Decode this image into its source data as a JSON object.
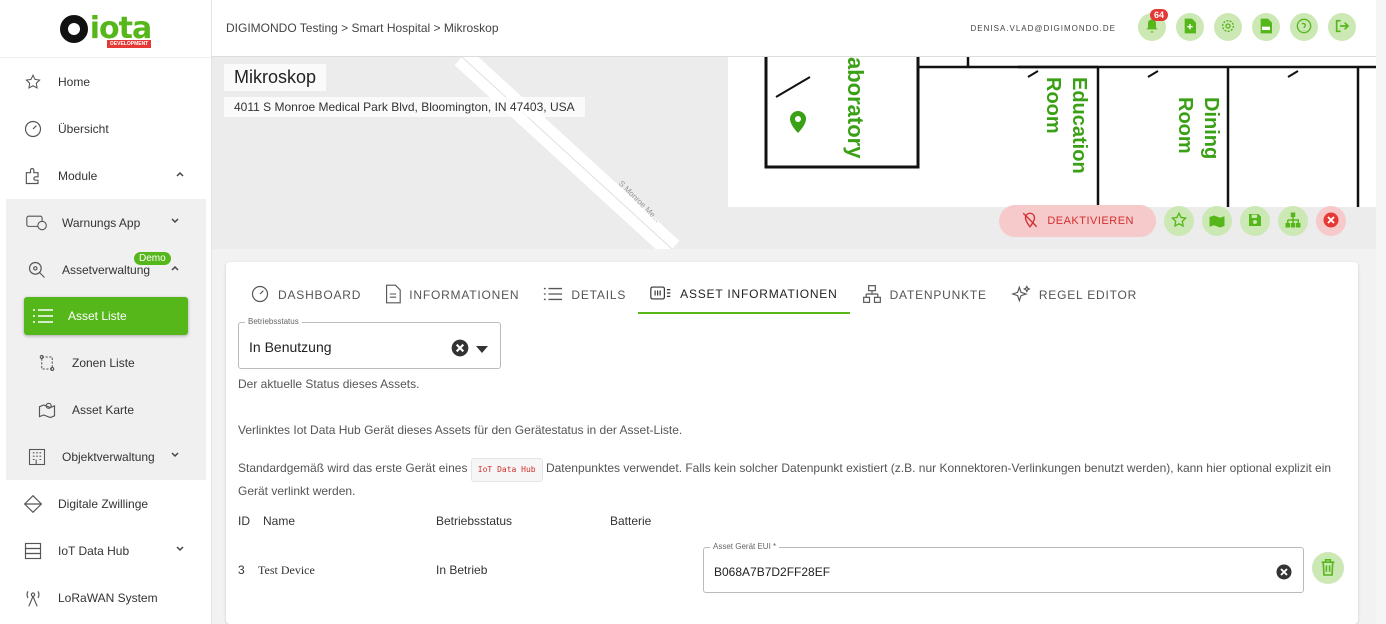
{
  "brand": {
    "logo_text": "iota",
    "logo_tag": "DEVELOPMENT",
    "accent": "#56b71b"
  },
  "sidebar": {
    "items": [
      {
        "label": "Home",
        "icon": "star-icon"
      },
      {
        "label": "Übersicht",
        "icon": "gauge-icon"
      },
      {
        "label": "Module",
        "icon": "puzzle-icon"
      },
      {
        "label": "Warnungs App",
        "icon": "alarm-icon"
      },
      {
        "label": "Assetverwaltung",
        "icon": "search-pin-icon",
        "badge": "Demo"
      },
      {
        "label": "Asset Liste",
        "icon": "list-icon"
      },
      {
        "label": "Zonen Liste",
        "icon": "zone-icon"
      },
      {
        "label": "Asset Karte",
        "icon": "map-icon"
      },
      {
        "label": "Objektverwaltung",
        "icon": "building-icon"
      },
      {
        "label": "Digitale Zwillinge",
        "icon": "diamond-icon"
      },
      {
        "label": "IoT Data Hub",
        "icon": "server-icon"
      },
      {
        "label": "LoRaWAN System",
        "icon": "antenna-icon"
      }
    ]
  },
  "header": {
    "breadcrumb": "DIGIMONDO Testing > Smart Hospital > Mikroskop",
    "user_email": "DENISA.VLAD@DIGIMONDO.DE",
    "notification_count": "64"
  },
  "map": {
    "asset_name": "Mikroskop",
    "address": "4011 S Monroe Medical Park Blvd, Bloomington, IN 47403, USA",
    "street_label": "S Monroe Me...",
    "rooms": [
      "aboratory",
      "Education Room",
      "Dining Room"
    ]
  },
  "actions": {
    "deactivate_label": "DEAKTIVIEREN"
  },
  "tabs": [
    {
      "label": "DASHBOARD",
      "icon": "gauge-icon"
    },
    {
      "label": "INFORMATIONEN",
      "icon": "document-icon"
    },
    {
      "label": "DETAILS",
      "icon": "list-icon"
    },
    {
      "label": "ASSET INFORMATIONEN",
      "icon": "asset-info-icon",
      "active": true
    },
    {
      "label": "DATENPUNKTE",
      "icon": "hierarchy-icon"
    },
    {
      "label": "REGEL EDITOR",
      "icon": "sparkle-icon"
    }
  ],
  "status_field": {
    "legend": "Betriebsstatus",
    "value": "In Benutzung",
    "hint": "Der aktuelle Status dieses Assets."
  },
  "linked_text": "Verlinktes Iot Data Hub Gerät dieses Assets für den Gerätestatus in der Asset-Liste.",
  "default_text": {
    "before": "Standardgemäß wird das erste Gerät eines",
    "chip": "IoT Data Hub",
    "after": "Datenpunktes verwendet. Falls kein solcher Datenpunkt existiert (z.B. nur Konnektoren-Verlinkungen benutzt werden), kann hier optional explizit ein Gerät verlinkt werden."
  },
  "table": {
    "headers": {
      "id": "ID",
      "name": "Name",
      "status": "Betriebsstatus",
      "battery": "Batterie"
    },
    "row": {
      "id": "3",
      "name": "Test Device",
      "status": "In Betrieb"
    }
  },
  "eui_field": {
    "legend": "Asset Gerät EUI *",
    "value": "B068A7B7D2FF28EF"
  }
}
